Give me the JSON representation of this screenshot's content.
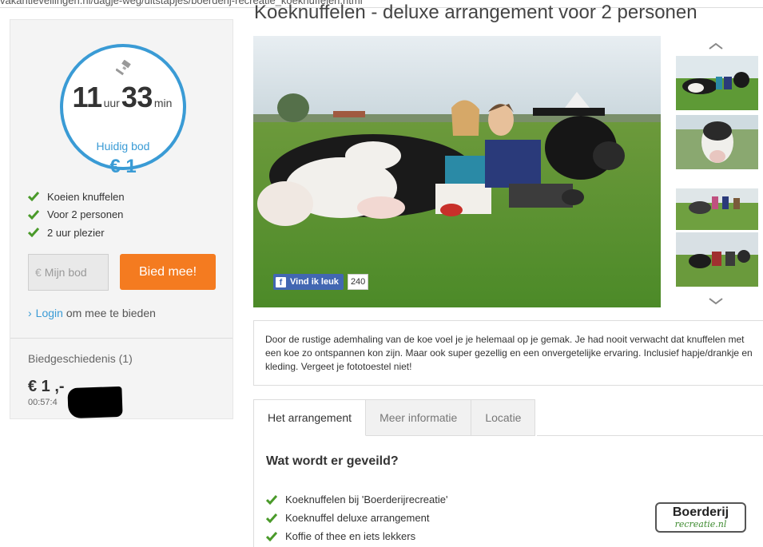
{
  "browser": {
    "url": "vakantieveilingen.nl/dagje-weg/uitstapjes/boerderij-recreatie_koeknuffelen.html"
  },
  "auction": {
    "timer_hours": "11",
    "timer_hours_unit": "uur",
    "timer_minutes": "33",
    "timer_minutes_unit": "min",
    "current_bid_label": "Huidig bod",
    "current_bid_value": "€ 1"
  },
  "features": [
    "Koeien knuffelen",
    "Voor 2 personen",
    "2 uur plezier"
  ],
  "bid_form": {
    "currency_symbol": "€",
    "placeholder": "Mijn bod",
    "button_label": "Bied mee!"
  },
  "login": {
    "link_text": "Login",
    "suffix": "om mee te bieden"
  },
  "history": {
    "title": "Biedgeschiedenis (1)",
    "amount": "€ 1 ,-",
    "time": "00:57:4"
  },
  "product": {
    "title": "Koeknuffelen - deluxe arrangement voor 2 personen",
    "description": "Door de rustige ademhaling van de koe voel je je helemaal op je gemak. Je had nooit verwacht dat knuffelen met een koe zo ontspannen kon zijn. Maar ook super gezellig en een onvergetelijke ervaring. Inclusief hapje/drankje en kleding. Vergeet je fototoestel niet!"
  },
  "facebook": {
    "like_label": "Vind ik leuk",
    "count": "240"
  },
  "tabs": [
    "Het arrangement",
    "Meer informatie",
    "Locatie"
  ],
  "arrangement": {
    "heading": "Wat wordt er geveild?",
    "items": [
      "Koeknuffelen bij 'Boerderijrecreatie'",
      "Koeknuffel deluxe arrangement",
      "Koffie of thee en iets lekkers"
    ]
  },
  "logo": {
    "line1": "Boerderij",
    "line2": "recreatie.nl"
  },
  "colors": {
    "accent_blue": "#3a9bd5",
    "bid_orange": "#f47b20",
    "check_green": "#4a9a2a",
    "facebook_blue": "#4267b2"
  }
}
